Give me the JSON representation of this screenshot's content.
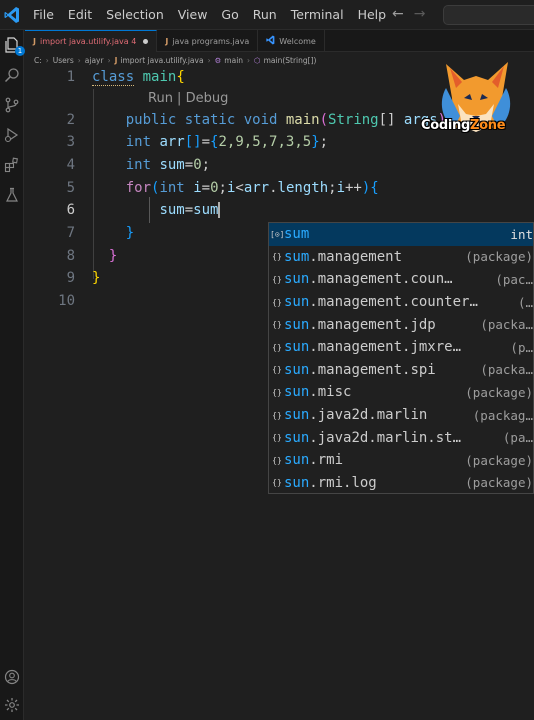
{
  "titlebar": {
    "menu": [
      "File",
      "Edit",
      "Selection",
      "View",
      "Go",
      "Run",
      "Terminal",
      "Help"
    ],
    "back_arrow": "←",
    "forward_arrow": "→"
  },
  "activity_bar": {
    "explorer_badge": "1",
    "icons": [
      "files-icon",
      "search-icon",
      "source-control-icon",
      "run-debug-icon",
      "extensions-icon",
      "testing-icon",
      "account-icon",
      "settings-gear-icon"
    ]
  },
  "tabs": [
    {
      "icon": "J",
      "label": "import java.utilify.java 4",
      "active": true,
      "modified": true
    },
    {
      "icon": "J",
      "label": "java programs.java",
      "active": false
    },
    {
      "icon": "vscode",
      "label": "Welcome",
      "active": false
    }
  ],
  "breadcrumb": [
    "C:",
    "Users",
    "ajayr",
    "import java.utilify.java",
    "main",
    "main(String[])"
  ],
  "editor": {
    "line_numbers": [
      "1",
      "2",
      "3",
      "4",
      "5",
      "6",
      "7",
      "8",
      "9",
      "10"
    ],
    "current_line": "6",
    "codelens": "Run | Debug",
    "lines": {
      "l1_kw": "class",
      "l1_name": "main",
      "l2_mods": "public static void",
      "l2_fn": "main",
      "l2_type": "String",
      "l3_kw": "int",
      "l3_var": "arr",
      "l3_values": "2,9,5,7,3,5",
      "l4_kw": "int",
      "l4_var": "sum",
      "l4_val": "0",
      "l5_kw": "for",
      "l5_type": "int",
      "l5_var": "i",
      "l5_init": "0",
      "l5_arr": "arr",
      "l5_len": "length",
      "l6_lhs": "sum",
      "l6_rhs": "sum"
    }
  },
  "watermark": {
    "text_main": "Coding",
    "text_accent": "Zone"
  },
  "suggestions": [
    {
      "icon": "[⊙]",
      "match": "sum",
      "rest": "",
      "detail": "int",
      "selected": true
    },
    {
      "icon": "{}",
      "match": "sum",
      "rest": ".management",
      "detail": "(package)"
    },
    {
      "icon": "{}",
      "match": "sun",
      "rest": ".management.coun…",
      "detail": "(pac…"
    },
    {
      "icon": "{}",
      "match": "sun",
      "rest": ".management.counter…",
      "detail": "(…"
    },
    {
      "icon": "{}",
      "match": "sun",
      "rest": ".management.jdp",
      "detail": "(packa…"
    },
    {
      "icon": "{}",
      "match": "sun",
      "rest": ".management.jmxre…",
      "detail": "(p…"
    },
    {
      "icon": "{}",
      "match": "sun",
      "rest": ".management.spi",
      "detail": "(packa…"
    },
    {
      "icon": "{}",
      "match": "sun",
      "rest": ".misc",
      "detail": "(package)"
    },
    {
      "icon": "{}",
      "match": "sun",
      "rest": ".java2d.marlin",
      "detail": "(packag…"
    },
    {
      "icon": "{}",
      "match": "sun",
      "rest": ".java2d.marlin.st…",
      "detail": "(pa…"
    },
    {
      "icon": "{}",
      "match": "sun",
      "rest": ".rmi",
      "detail": "(package)"
    },
    {
      "icon": "{}",
      "match": "sun",
      "rest": ".rmi.log",
      "detail": "(package)"
    }
  ],
  "colors": {
    "accent": "#0078d4",
    "keyword": "#569cd6",
    "type": "#4ec9b0",
    "variable": "#9cdcfe",
    "function": "#dcdcaa",
    "number": "#b5cea8",
    "match_highlight": "#2aaaff",
    "selection_bg": "#04395e"
  }
}
